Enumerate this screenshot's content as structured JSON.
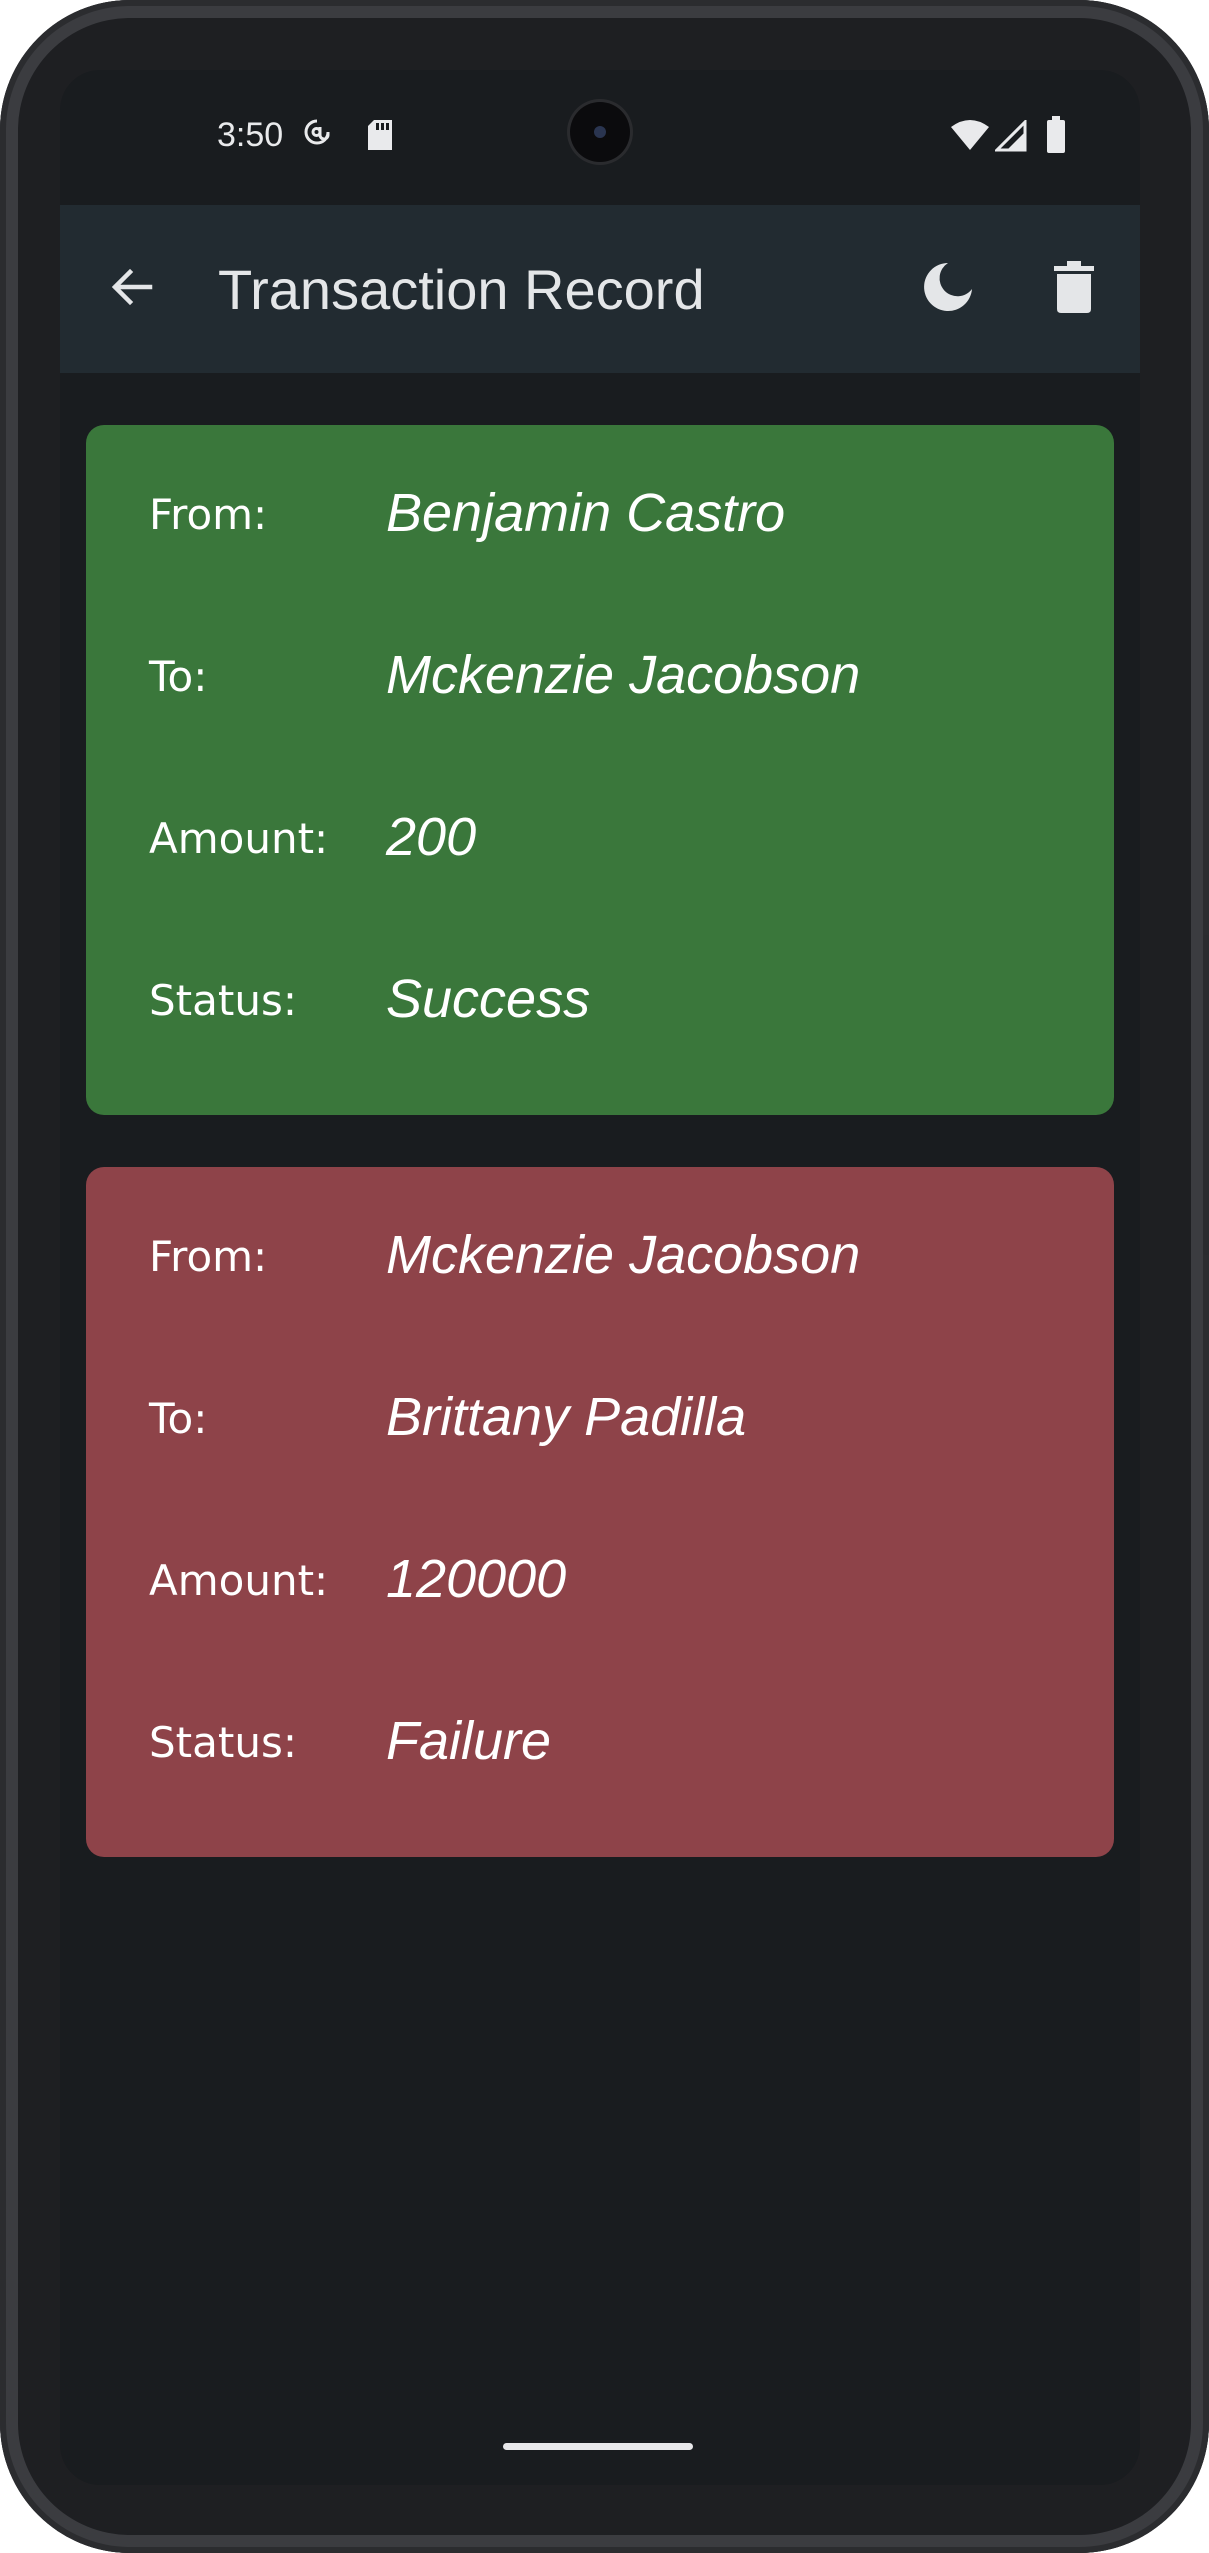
{
  "status_bar": {
    "time": "3:50",
    "icons_left": [
      "at-sign-icon",
      "sd-card-icon"
    ],
    "icons_right": [
      "wifi-icon",
      "signal-icon",
      "battery-icon"
    ]
  },
  "app_bar": {
    "title": "Transaction Record",
    "back_icon": "arrow-back-icon",
    "actions": [
      "dark-mode-icon",
      "delete-icon"
    ]
  },
  "transactions": [
    {
      "card_color": "#3a773b",
      "rows": [
        {
          "label": "From:",
          "value": "Benjamin Castro"
        },
        {
          "label": "To:",
          "value": "Mckenzie Jacobson"
        },
        {
          "label": "Amount:",
          "value": "200"
        },
        {
          "label": "Status:",
          "value": "Success"
        }
      ]
    },
    {
      "card_color": "#8e4349",
      "rows": [
        {
          "label": "From:",
          "value": "Mckenzie Jacobson"
        },
        {
          "label": "To:",
          "value": "Brittany Padilla"
        },
        {
          "label": "Amount:",
          "value": "120000"
        },
        {
          "label": "Status:",
          "value": "Failure"
        }
      ]
    }
  ],
  "colors": {
    "screen_background": "#191c1f",
    "app_bar_background": "#222b31",
    "success": "#3a773b",
    "failure": "#8e4349"
  }
}
